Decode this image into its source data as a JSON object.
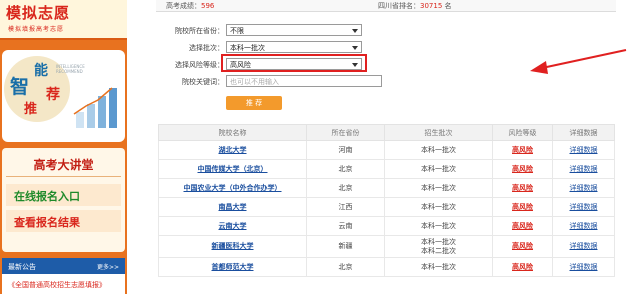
{
  "sidebar": {
    "logo_title": "模拟志愿",
    "logo_sub": "模拟填报高考志愿",
    "smart": {
      "zhi": "智",
      "neng": "能",
      "tui": "推",
      "jian": "荐",
      "english": "INTELLIGENCE RECOMMEND"
    },
    "lecture_title": "高考大讲堂",
    "online_signup": "在线报名入口",
    "view_results": "查看报名结果",
    "notice_title": "最新公告",
    "notice_more": "更多>>",
    "notice_item": "《全国普通高校招生志愿填报》"
  },
  "score": {
    "score_label": "高考成绩：",
    "score_value": "596",
    "rank_label": "四川省排名：",
    "rank_value": "30715",
    "rank_unit": "名"
  },
  "form": {
    "province_label": "院校所在省份：",
    "province_value": "不限",
    "batch_label": "选择批次：",
    "batch_value": "本科一批次",
    "risk_label": "选择风险等级：",
    "risk_value": "高风险",
    "keyword_label": "院校关键词：",
    "keyword_placeholder": "也可以不用输入",
    "submit_label": "推 荐"
  },
  "table": {
    "headers": [
      "院校名称",
      "所在省份",
      "招生批次",
      "风险等级",
      "详细数据"
    ],
    "rows": [
      {
        "school": "湖北大学",
        "province": "河南",
        "batch": "本科一批次",
        "batch2": "",
        "risk": "高风险",
        "detail": "详细数据"
      },
      {
        "school": "中国传媒大学（北京）",
        "province": "北京",
        "batch": "本科一批次",
        "batch2": "",
        "risk": "高风险",
        "detail": "详细数据"
      },
      {
        "school": "中国农业大学（中外合作办学）",
        "province": "北京",
        "batch": "本科一批次",
        "batch2": "",
        "risk": "高风险",
        "detail": "详细数据"
      },
      {
        "school": "南昌大学",
        "province": "江西",
        "batch": "本科一批次",
        "batch2": "",
        "risk": "高风险",
        "detail": "详细数据"
      },
      {
        "school": "云南大学",
        "province": "云南",
        "batch": "本科一批次",
        "batch2": "",
        "risk": "高风险",
        "detail": "详细数据"
      },
      {
        "school": "新疆医科大学",
        "province": "新疆",
        "batch": "本科一批次",
        "batch2": "本科二批次",
        "risk": "高风险",
        "detail": "详细数据"
      },
      {
        "school": "首都师范大学",
        "province": "北京",
        "batch": "本科一批次",
        "batch2": "",
        "risk": "高风险",
        "detail": "详细数据"
      }
    ]
  },
  "colors": {
    "accent_orange": "#e8721f",
    "risk_red": "#d9261c",
    "link_blue": "#1a4e9e",
    "highlight_red": "#e02020"
  }
}
